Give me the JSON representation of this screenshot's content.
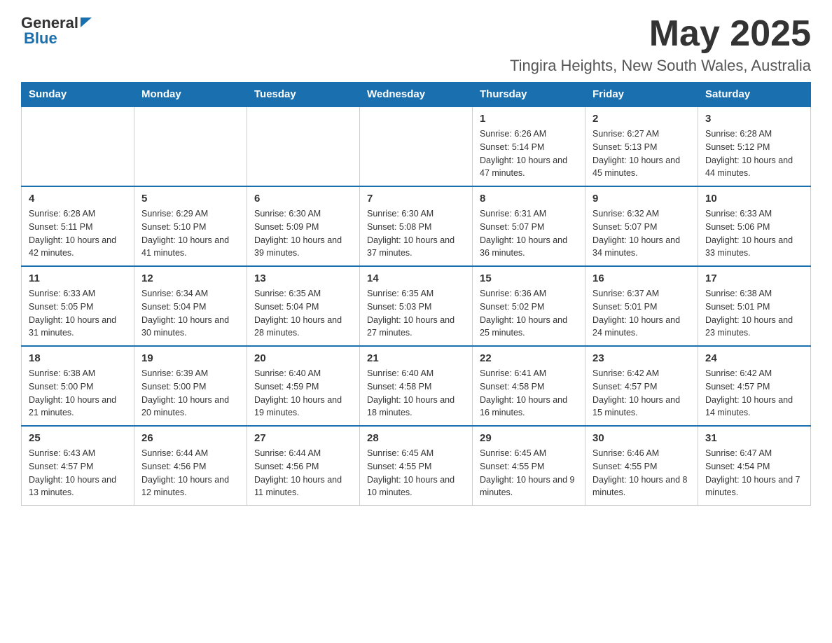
{
  "header": {
    "logo": {
      "general": "General",
      "blue": "Blue"
    },
    "month_year": "May 2025",
    "location": "Tingira Heights, New South Wales, Australia"
  },
  "days_of_week": [
    "Sunday",
    "Monday",
    "Tuesday",
    "Wednesday",
    "Thursday",
    "Friday",
    "Saturday"
  ],
  "weeks": [
    {
      "days": [
        {
          "number": "",
          "info": ""
        },
        {
          "number": "",
          "info": ""
        },
        {
          "number": "",
          "info": ""
        },
        {
          "number": "",
          "info": ""
        },
        {
          "number": "1",
          "info": "Sunrise: 6:26 AM\nSunset: 5:14 PM\nDaylight: 10 hours and 47 minutes."
        },
        {
          "number": "2",
          "info": "Sunrise: 6:27 AM\nSunset: 5:13 PM\nDaylight: 10 hours and 45 minutes."
        },
        {
          "number": "3",
          "info": "Sunrise: 6:28 AM\nSunset: 5:12 PM\nDaylight: 10 hours and 44 minutes."
        }
      ]
    },
    {
      "days": [
        {
          "number": "4",
          "info": "Sunrise: 6:28 AM\nSunset: 5:11 PM\nDaylight: 10 hours and 42 minutes."
        },
        {
          "number": "5",
          "info": "Sunrise: 6:29 AM\nSunset: 5:10 PM\nDaylight: 10 hours and 41 minutes."
        },
        {
          "number": "6",
          "info": "Sunrise: 6:30 AM\nSunset: 5:09 PM\nDaylight: 10 hours and 39 minutes."
        },
        {
          "number": "7",
          "info": "Sunrise: 6:30 AM\nSunset: 5:08 PM\nDaylight: 10 hours and 37 minutes."
        },
        {
          "number": "8",
          "info": "Sunrise: 6:31 AM\nSunset: 5:07 PM\nDaylight: 10 hours and 36 minutes."
        },
        {
          "number": "9",
          "info": "Sunrise: 6:32 AM\nSunset: 5:07 PM\nDaylight: 10 hours and 34 minutes."
        },
        {
          "number": "10",
          "info": "Sunrise: 6:33 AM\nSunset: 5:06 PM\nDaylight: 10 hours and 33 minutes."
        }
      ]
    },
    {
      "days": [
        {
          "number": "11",
          "info": "Sunrise: 6:33 AM\nSunset: 5:05 PM\nDaylight: 10 hours and 31 minutes."
        },
        {
          "number": "12",
          "info": "Sunrise: 6:34 AM\nSunset: 5:04 PM\nDaylight: 10 hours and 30 minutes."
        },
        {
          "number": "13",
          "info": "Sunrise: 6:35 AM\nSunset: 5:04 PM\nDaylight: 10 hours and 28 minutes."
        },
        {
          "number": "14",
          "info": "Sunrise: 6:35 AM\nSunset: 5:03 PM\nDaylight: 10 hours and 27 minutes."
        },
        {
          "number": "15",
          "info": "Sunrise: 6:36 AM\nSunset: 5:02 PM\nDaylight: 10 hours and 25 minutes."
        },
        {
          "number": "16",
          "info": "Sunrise: 6:37 AM\nSunset: 5:01 PM\nDaylight: 10 hours and 24 minutes."
        },
        {
          "number": "17",
          "info": "Sunrise: 6:38 AM\nSunset: 5:01 PM\nDaylight: 10 hours and 23 minutes."
        }
      ]
    },
    {
      "days": [
        {
          "number": "18",
          "info": "Sunrise: 6:38 AM\nSunset: 5:00 PM\nDaylight: 10 hours and 21 minutes."
        },
        {
          "number": "19",
          "info": "Sunrise: 6:39 AM\nSunset: 5:00 PM\nDaylight: 10 hours and 20 minutes."
        },
        {
          "number": "20",
          "info": "Sunrise: 6:40 AM\nSunset: 4:59 PM\nDaylight: 10 hours and 19 minutes."
        },
        {
          "number": "21",
          "info": "Sunrise: 6:40 AM\nSunset: 4:58 PM\nDaylight: 10 hours and 18 minutes."
        },
        {
          "number": "22",
          "info": "Sunrise: 6:41 AM\nSunset: 4:58 PM\nDaylight: 10 hours and 16 minutes."
        },
        {
          "number": "23",
          "info": "Sunrise: 6:42 AM\nSunset: 4:57 PM\nDaylight: 10 hours and 15 minutes."
        },
        {
          "number": "24",
          "info": "Sunrise: 6:42 AM\nSunset: 4:57 PM\nDaylight: 10 hours and 14 minutes."
        }
      ]
    },
    {
      "days": [
        {
          "number": "25",
          "info": "Sunrise: 6:43 AM\nSunset: 4:57 PM\nDaylight: 10 hours and 13 minutes."
        },
        {
          "number": "26",
          "info": "Sunrise: 6:44 AM\nSunset: 4:56 PM\nDaylight: 10 hours and 12 minutes."
        },
        {
          "number": "27",
          "info": "Sunrise: 6:44 AM\nSunset: 4:56 PM\nDaylight: 10 hours and 11 minutes."
        },
        {
          "number": "28",
          "info": "Sunrise: 6:45 AM\nSunset: 4:55 PM\nDaylight: 10 hours and 10 minutes."
        },
        {
          "number": "29",
          "info": "Sunrise: 6:45 AM\nSunset: 4:55 PM\nDaylight: 10 hours and 9 minutes."
        },
        {
          "number": "30",
          "info": "Sunrise: 6:46 AM\nSunset: 4:55 PM\nDaylight: 10 hours and 8 minutes."
        },
        {
          "number": "31",
          "info": "Sunrise: 6:47 AM\nSunset: 4:54 PM\nDaylight: 10 hours and 7 minutes."
        }
      ]
    }
  ]
}
